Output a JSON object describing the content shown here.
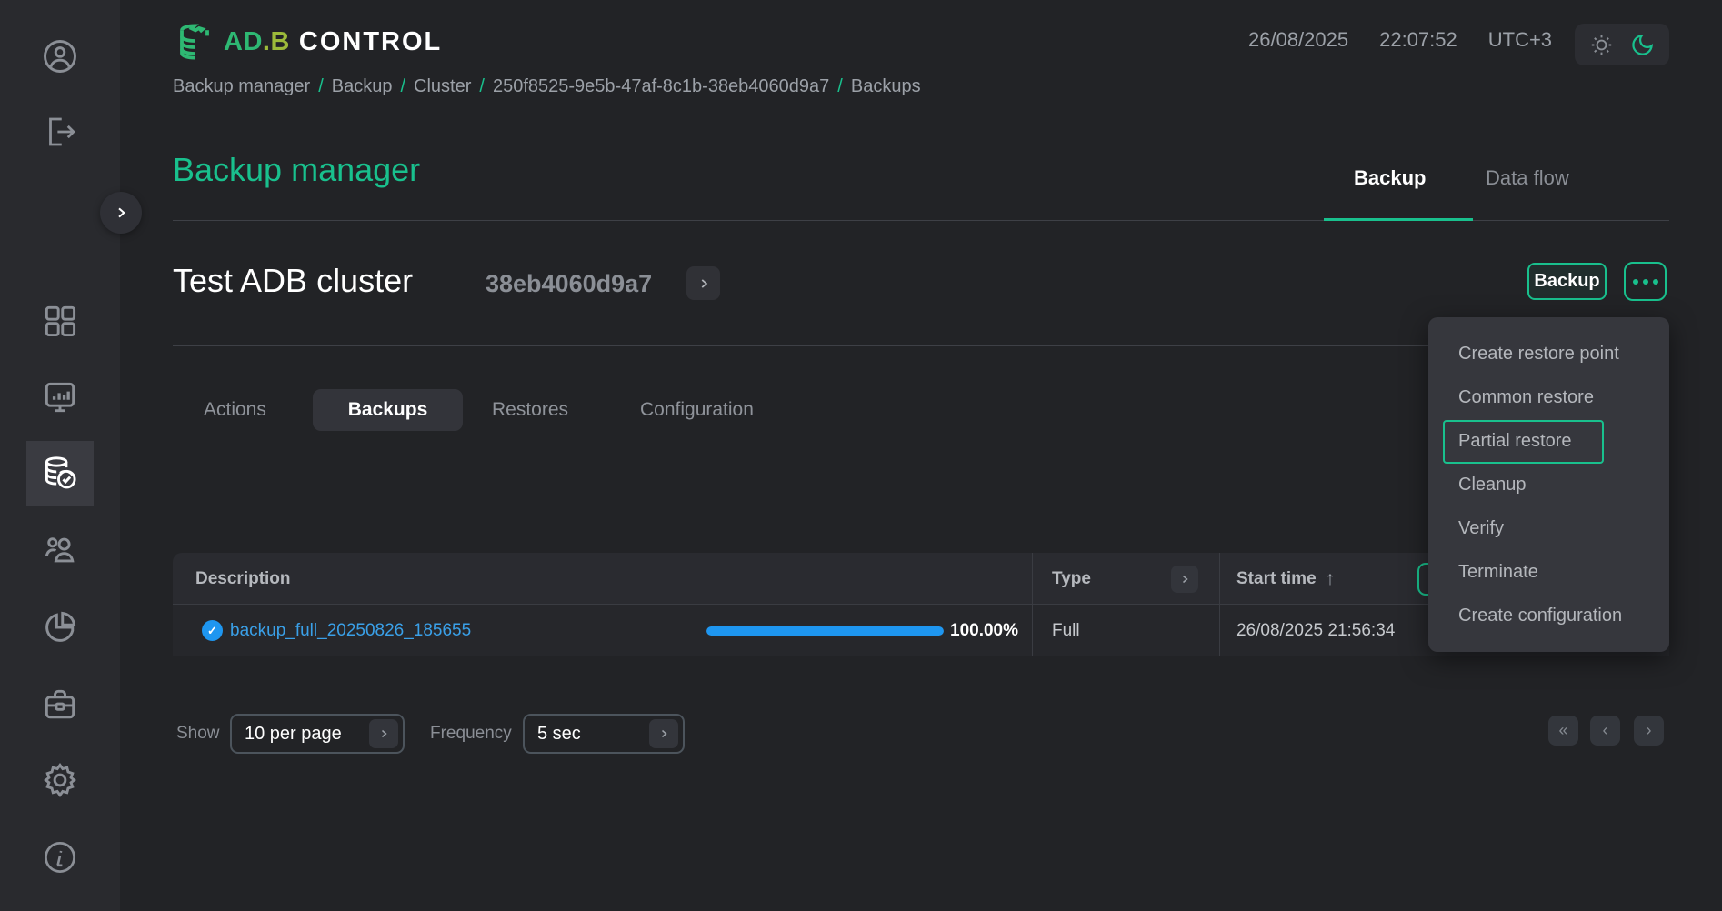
{
  "header": {
    "logo": {
      "part_green": "AD",
      "part_lime": ".B",
      "part_rest": "CONTROL"
    },
    "datetime": {
      "date": "26/08/2025",
      "time": "22:07:52",
      "timezone": "UTC+3"
    },
    "breadcrumb": {
      "separator": "/",
      "items": [
        "Backup manager",
        "Backup",
        "Cluster",
        "250f8525-9e5b-47af-8c1b-38eb4060d9a7",
        "Backups"
      ]
    },
    "page_title": "Backup manager",
    "top_tabs": [
      {
        "label": "Backup",
        "active": true
      },
      {
        "label": "Data flow",
        "active": false
      }
    ]
  },
  "cluster": {
    "name": "Test ADB cluster",
    "id": "38eb4060d9a7",
    "backup_button": "Backup"
  },
  "menu": {
    "focused": "Partial restore",
    "items": [
      "Create restore point",
      "Common restore",
      "Partial restore",
      "Cleanup",
      "Verify",
      "Terminate",
      "Create configuration"
    ]
  },
  "tabs": [
    {
      "label": "Actions",
      "active": false
    },
    {
      "label": "Backups",
      "active": true
    },
    {
      "label": "Restores",
      "active": false
    },
    {
      "label": "Configuration",
      "active": false
    }
  ],
  "table": {
    "columns": [
      "Description",
      "Type",
      "Start time"
    ],
    "sort_icon": "↑",
    "rows": [
      {
        "status": "complete",
        "description": "backup_full_20250826_185655",
        "progress": "100.00%",
        "progress_value": 100,
        "type": "Full",
        "start_time": "26/08/2025 21:56:34"
      }
    ]
  },
  "footer": {
    "show_label": "Show",
    "show_value": "10 per page",
    "frequency_label": "Frequency",
    "frequency_value": "5 sec",
    "pagination": [
      "«",
      "‹",
      "›"
    ]
  },
  "glyphs": {
    "chevron": "›",
    "check": "✓"
  },
  "colors": {
    "accent": "#19c08d",
    "link": "#3aa0e8",
    "progress": "#1e96f0",
    "logo_green": "#2eb873",
    "logo_lime": "#9cba3a"
  }
}
